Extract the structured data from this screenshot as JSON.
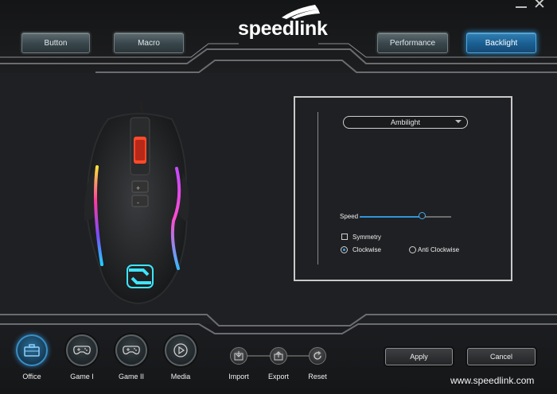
{
  "header": {
    "logo": "speedlink",
    "window_controls": {
      "minimize_icon": "minimize-icon",
      "close_icon": "close-icon"
    },
    "tabs": [
      {
        "label": "Button",
        "active": false
      },
      {
        "label": "Macro",
        "active": false
      },
      {
        "label": "Performance",
        "active": false
      },
      {
        "label": "Backlight",
        "active": true
      }
    ]
  },
  "backlight": {
    "mode": "Ambilight",
    "speed_label": "Speed",
    "speed_fraction": 0.68,
    "symmetry_label": "Symmetry",
    "symmetry_checked": false,
    "direction_options": [
      {
        "label": "Clockwise",
        "selected": true
      },
      {
        "label": "Anti Clockwise",
        "selected": false
      }
    ]
  },
  "profiles": [
    {
      "label": "Office",
      "icon": "briefcase-icon",
      "active": true
    },
    {
      "label": "Game I",
      "icon": "gamepad-icon",
      "active": false
    },
    {
      "label": "Game II",
      "icon": "gamepad-icon",
      "active": false
    },
    {
      "label": "Media",
      "icon": "play-icon",
      "active": false
    }
  ],
  "file_actions": [
    {
      "label": "Import",
      "icon": "import-icon"
    },
    {
      "label": "Export",
      "icon": "export-icon"
    },
    {
      "label": "Reset",
      "icon": "reset-icon"
    }
  ],
  "actions": {
    "apply_label": "Apply",
    "cancel_label": "Cancel"
  },
  "footer": {
    "url": "www.speedlink.com"
  },
  "colors": {
    "accent": "#2f95d8",
    "active_tab": "#1a5e91",
    "background": "#1f2023"
  }
}
